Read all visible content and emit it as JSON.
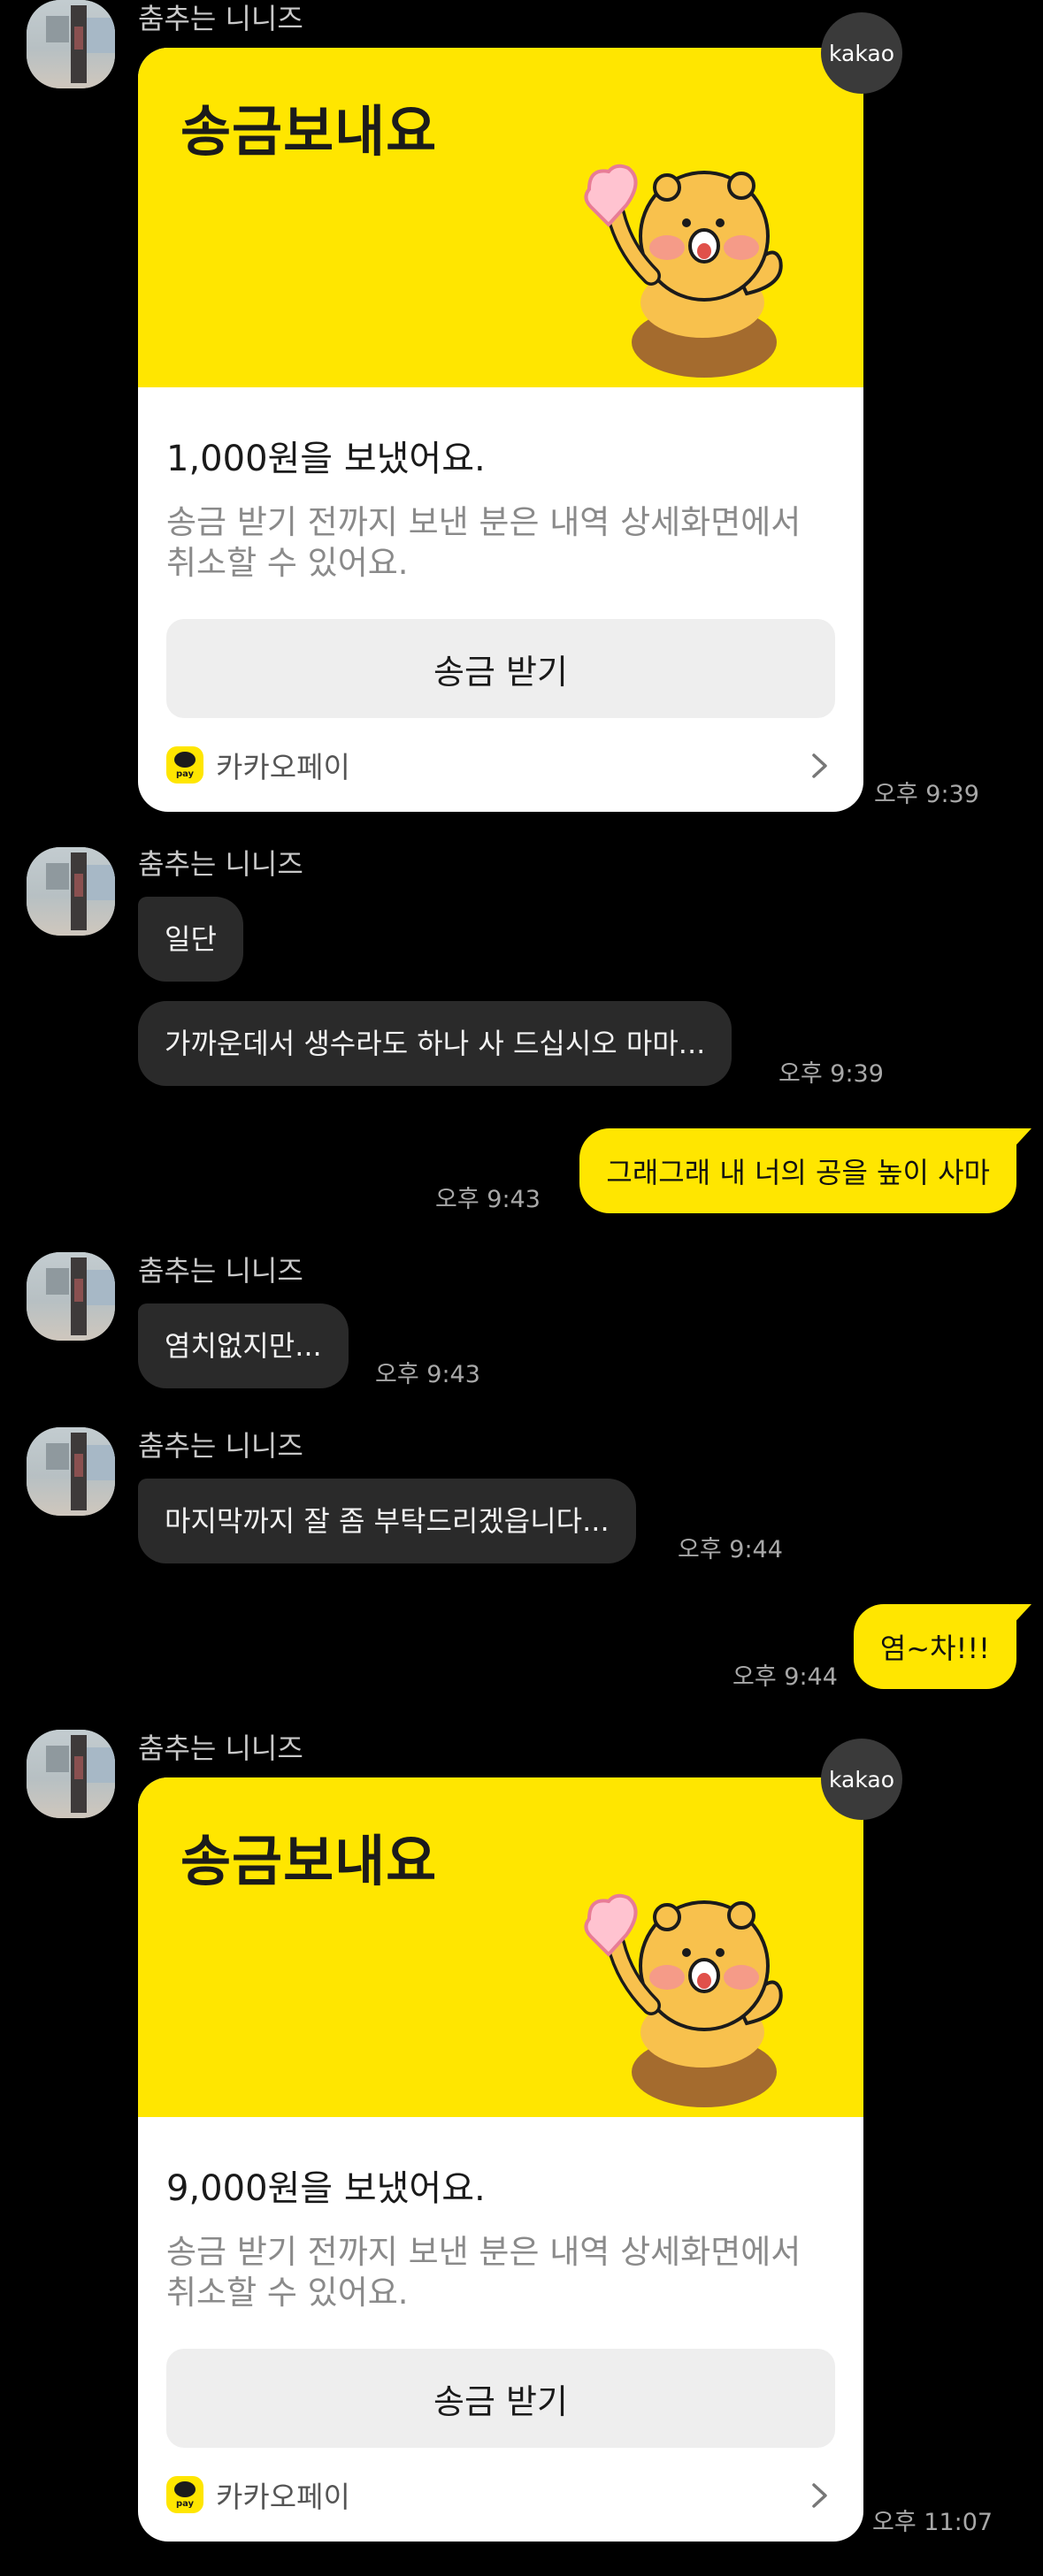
{
  "chat": {
    "messages": [
      {
        "type": "transfer",
        "sender": "춤추는 니니즈",
        "title": "송금보내요",
        "amount": "1,000원을 보냈어요.",
        "desc": "송금 받기 전까지 보낸 분은 내역 상세화면에서 취소할 수 있어요.",
        "button": "송금 받기",
        "pay_label": "카카오페이",
        "pay_icon_text": "pay",
        "badge": "kakao",
        "time": "오후 9:39"
      },
      {
        "type": "in",
        "sender": "춤추는 니니즈",
        "text": "일단"
      },
      {
        "type": "in",
        "text": "가까운데서 생수라도 하나 사 드십시오 마마...",
        "time": "오후 9:39"
      },
      {
        "type": "out",
        "text": "그래그래 내 너의 공을 높이 사마",
        "time": "오후 9:43"
      },
      {
        "type": "in",
        "sender": "춤추는 니니즈",
        "text": "염치없지만...",
        "time": "오후 9:43"
      },
      {
        "type": "in",
        "sender": "춤추는 니니즈",
        "text": "마지막까지 잘 좀 부탁드리겠읍니다...",
        "time": "오후 9:44"
      },
      {
        "type": "out",
        "text": "염~차!!!",
        "time": "오후 9:44"
      },
      {
        "type": "transfer",
        "sender": "춤추는 니니즈",
        "title": "송금보내요",
        "amount": "9,000원을 보냈어요.",
        "desc": "송금 받기 전까지 보낸 분은 내역 상세화면에서 취소할 수 있어요.",
        "button": "송금 받기",
        "pay_label": "카카오페이",
        "pay_icon_text": "pay",
        "badge": "kakao",
        "time": "오후 11:07"
      }
    ]
  },
  "colors": {
    "background": "#000000",
    "accent": "#ffe600",
    "incoming_bubble": "#2a2a2a"
  }
}
